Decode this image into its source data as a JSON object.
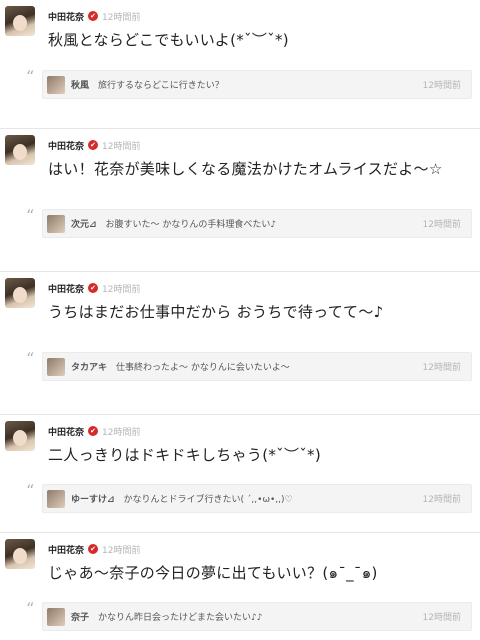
{
  "posts": [
    {
      "author": "中田花奈",
      "verified_mark": "✔",
      "time": "12時間前",
      "message": "秋風とならどこでもいいよ(*ˇ︶ˇ*)",
      "reply": {
        "name": "秋風",
        "text": "旅行するならどこに行きたい？",
        "time": "12時間前"
      }
    },
    {
      "author": "中田花奈",
      "verified_mark": "✔",
      "time": "12時間前",
      "message": "はい！花奈が美味しくなる魔法かけたオムライスだよ〜☆",
      "reply": {
        "name": "次元⊿",
        "text": "お腹すいた〜 かなりんの手料理食べたい♪",
        "time": "12時間前"
      }
    },
    {
      "author": "中田花奈",
      "verified_mark": "✔",
      "time": "12時間前",
      "message": "うちはまだお仕事中だから おうちで待ってて〜♪",
      "reply": {
        "name": "タカアキ",
        "text": "仕事終わったよ〜 かなりんに会いたいよ〜",
        "time": "12時間前"
      }
    },
    {
      "author": "中田花奈",
      "verified_mark": "✔",
      "time": "12時間前",
      "message": "二人っきりはドキドキしちゃう(*ˇ︶ˇ*)",
      "reply": {
        "name": "ゆーすけ⊿",
        "text": "かなりんとドライブ行きたい( ´,,•ω•,,)♡",
        "time": "12時間前"
      }
    },
    {
      "author": "中田花奈",
      "verified_mark": "✔",
      "time": "12時間前",
      "message": "じゃあ〜奈子の今日の夢に出てもいい？(๑¯_¯๑)",
      "reply": {
        "name": "奈子",
        "text": "かなりん昨日会ったけどまた会いたい♪♪",
        "time": "12時間前"
      }
    }
  ],
  "quote_glyph": "“",
  "colors": {
    "verified": "#d62929",
    "reply_bg": "#f4f4f4",
    "muted_time": "#b5b5b5"
  }
}
